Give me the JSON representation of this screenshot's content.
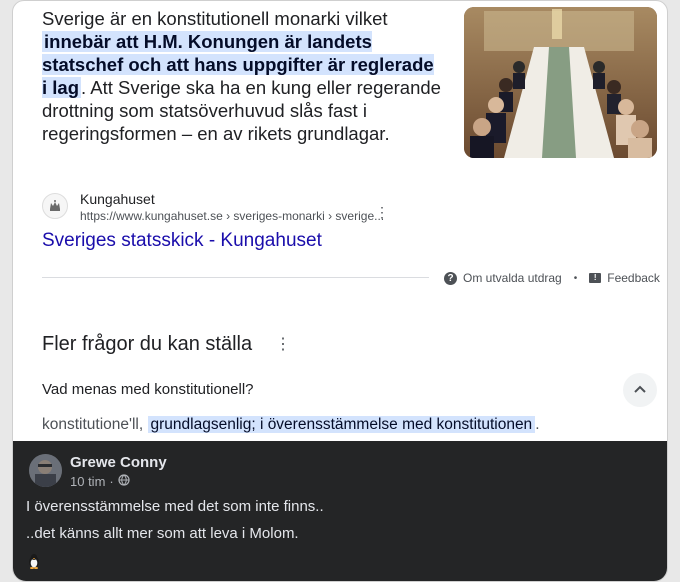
{
  "snippet": {
    "before": "Sverige är en konstitutionell monarki vilket",
    "highlight": "innebär att H.M. Konungen är landets statschef och att hans uppgifter är reglerade i lag",
    "after": ". Att Sverige ska ha en kung eller regerande drottning som statsöverhuvud slås fast i regeringsformen – en av rikets grundlagar."
  },
  "source": {
    "site_name": "Kungahuset",
    "url": "https://www.kungahuset.se › sveriges-monarki › sverige...",
    "link_title": "Sveriges statsskick - Kungahuset",
    "favicon_icon": "crown-crest-icon",
    "menu_icon": "more-vert-icon"
  },
  "footer_links": {
    "about": "Om utvalda utdrag",
    "separator": "•",
    "feedback": "Feedback"
  },
  "paa": {
    "title": "Fler frågor du kan ställa",
    "question": "Vad menas med konstitutionell?",
    "answer_prefix": "konstitutione'll,",
    "answer_highlight": "grundlagsenlig; i överensstämmelse med konstitutionen",
    "answer_suffix": ".",
    "chevron_icon": "chevron-up-icon"
  },
  "post": {
    "author": "Grewe Conny",
    "time": "10 tim",
    "time_separator": "·",
    "privacy_icon": "globe-icon",
    "line1": "I överensstämmelse med det som inte finns..",
    "line2": "..det känns allt mer som att leva i Molom.",
    "emoji": "penguin-icon"
  },
  "colors": {
    "link": "#1a0dab",
    "highlight_bg": "#d3e3fd",
    "post_bg": "#242526"
  }
}
